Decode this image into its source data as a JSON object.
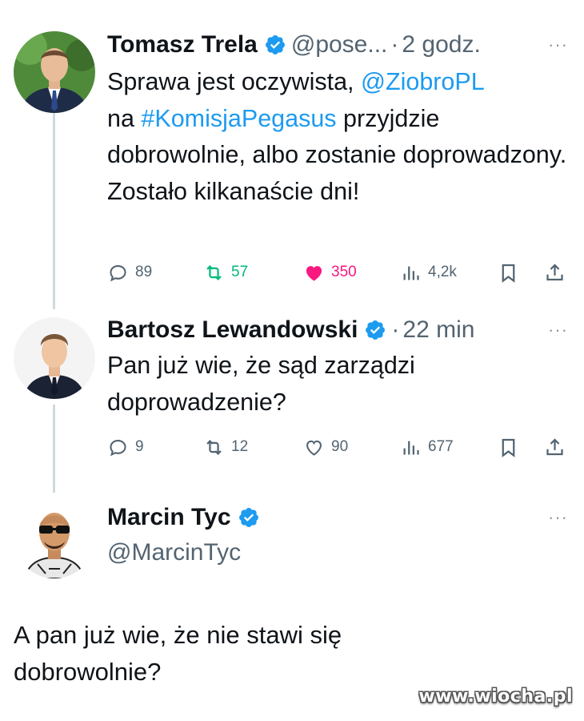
{
  "tweets": [
    {
      "name": "Tomasz Trela",
      "handle": "@pose...",
      "separator": "·",
      "time": "2 godz.",
      "more": "···",
      "text_parts": [
        "Sprawa jest oczywista, ",
        "@ZiobroPL",
        " na ",
        "#KomisjaPegasus",
        " przyjdzie dobrowolnie, albo zostanie doprowadzony. Zostało kilkanaście dni!"
      ],
      "stats": {
        "replies": "89",
        "reposts": "57",
        "likes": "350",
        "views": "4,2k"
      },
      "liked": true,
      "reposted": true
    },
    {
      "name": "Bartosz Lewandowski",
      "separator": "·",
      "time": "22 min",
      "more": "···",
      "text": "Pan już wie, że sąd zarządzi doprowadzenie?",
      "stats": {
        "replies": "9",
        "reposts": "12",
        "likes": "90",
        "views": "677"
      },
      "liked": false,
      "reposted": false
    },
    {
      "name": "Marcin Tyc",
      "handle": "@MarcinTyc",
      "more": "···"
    }
  ],
  "reply_text": "A pan już wie,  że nie stawi się dobrowolnie?",
  "watermark": "www.wiocha.pl",
  "colors": {
    "verified": "#1d9bf0",
    "link": "#1d9bf0",
    "repost": "#00ba7c",
    "like": "#f91880",
    "muted": "#536471",
    "thread": "#cfd9de"
  },
  "icons": [
    "verified-badge-icon",
    "reply-icon",
    "repost-icon",
    "like-icon",
    "views-icon",
    "bookmark-icon",
    "share-icon",
    "more-icon"
  ]
}
